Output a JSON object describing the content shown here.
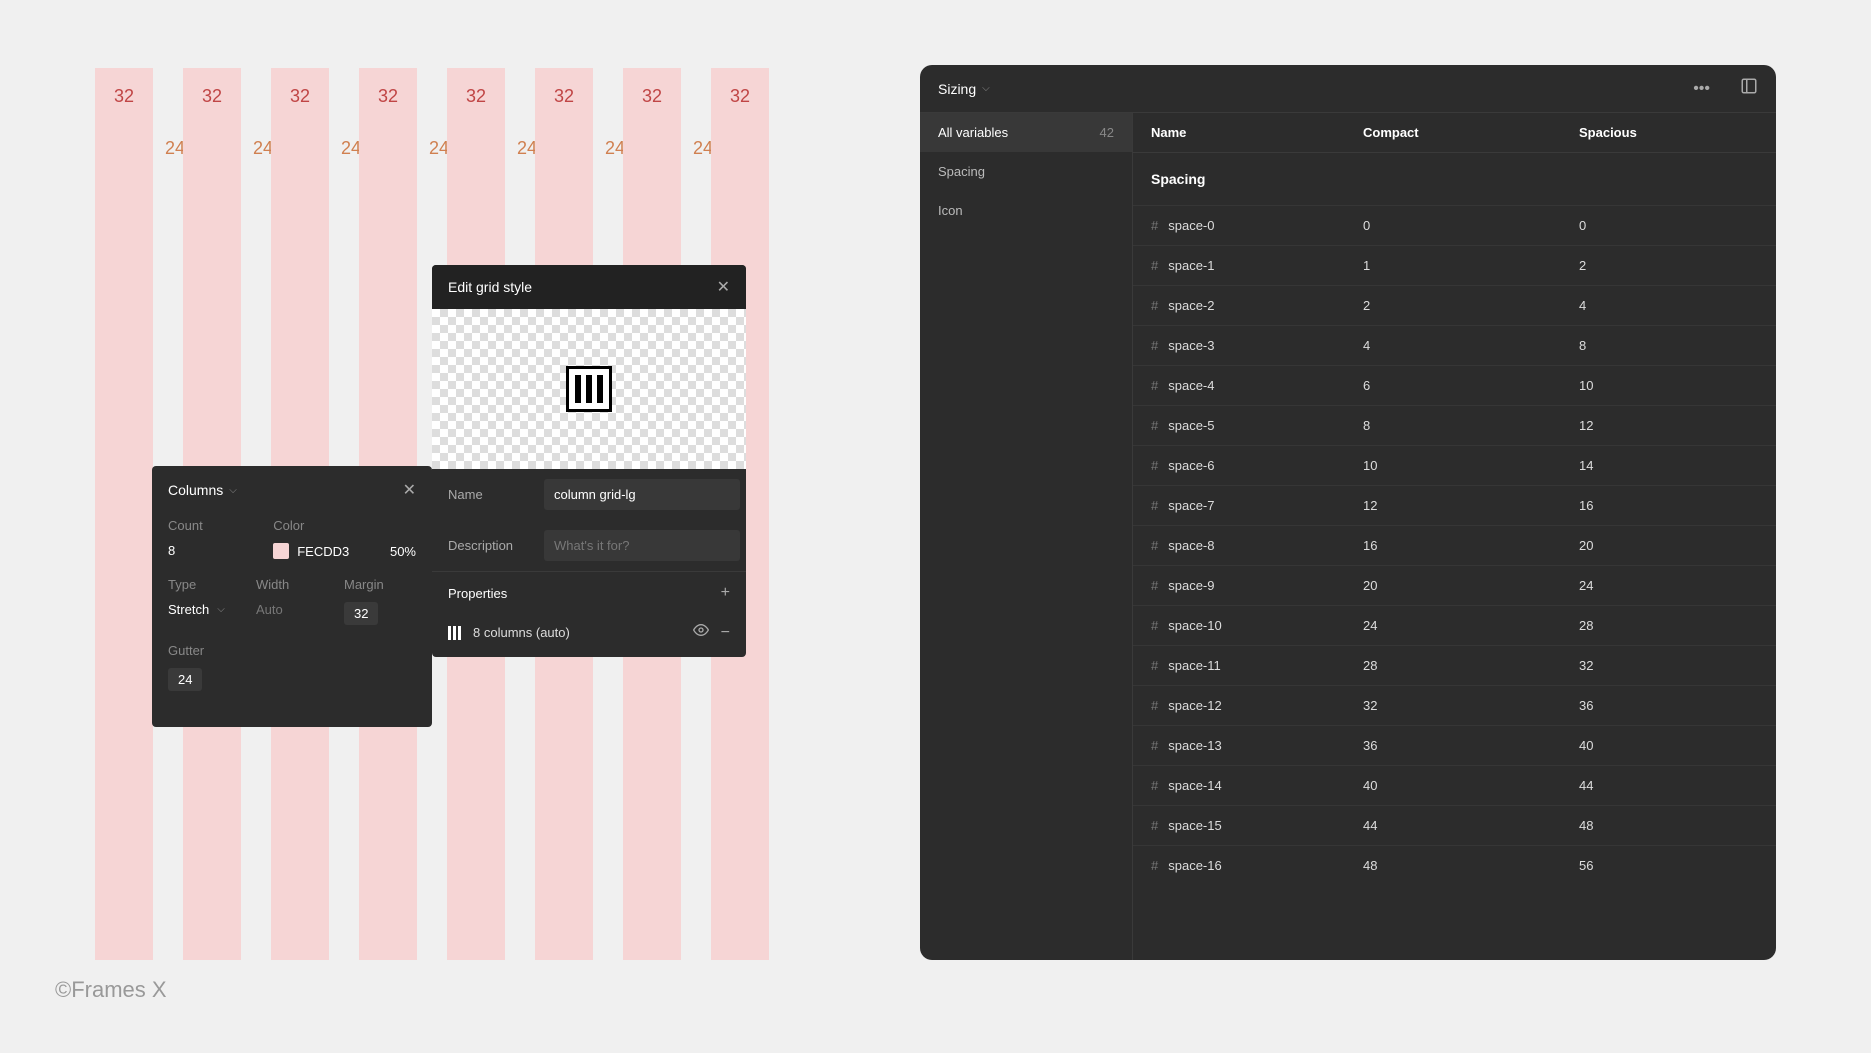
{
  "watermark": "©Frames X",
  "grid": {
    "col_label": "32",
    "gutter_label": "24"
  },
  "edit_panel": {
    "title": "Edit grid style",
    "name_label": "Name",
    "name_value": "column grid-lg",
    "desc_label": "Description",
    "desc_placeholder": "What's it for?",
    "properties_label": "Properties",
    "prop_text": "8 columns (auto)"
  },
  "columns_panel": {
    "title": "Columns",
    "count_label": "Count",
    "count_value": "8",
    "color_label": "Color",
    "color_hex": "FECDD3",
    "color_opacity": "50%",
    "type_label": "Type",
    "type_value": "Stretch",
    "width_label": "Width",
    "width_value": "Auto",
    "margin_label": "Margin",
    "margin_value": "32",
    "gutter_label": "Gutter",
    "gutter_value": "24"
  },
  "vars_panel": {
    "header": "Sizing",
    "sidebar": {
      "all_label": "All variables",
      "all_count": "42",
      "groups": [
        "Spacing",
        "Icon"
      ]
    },
    "columns": {
      "name": "Name",
      "compact": "Compact",
      "spacious": "Spacious"
    },
    "group_title": "Spacing",
    "rows": [
      {
        "name": "space-0",
        "compact": "0",
        "spacious": "0"
      },
      {
        "name": "space-1",
        "compact": "1",
        "spacious": "2"
      },
      {
        "name": "space-2",
        "compact": "2",
        "spacious": "4"
      },
      {
        "name": "space-3",
        "compact": "4",
        "spacious": "8"
      },
      {
        "name": "space-4",
        "compact": "6",
        "spacious": "10"
      },
      {
        "name": "space-5",
        "compact": "8",
        "spacious": "12"
      },
      {
        "name": "space-6",
        "compact": "10",
        "spacious": "14"
      },
      {
        "name": "space-7",
        "compact": "12",
        "spacious": "16"
      },
      {
        "name": "space-8",
        "compact": "16",
        "spacious": "20"
      },
      {
        "name": "space-9",
        "compact": "20",
        "spacious": "24"
      },
      {
        "name": "space-10",
        "compact": "24",
        "spacious": "28"
      },
      {
        "name": "space-11",
        "compact": "28",
        "spacious": "32"
      },
      {
        "name": "space-12",
        "compact": "32",
        "spacious": "36"
      },
      {
        "name": "space-13",
        "compact": "36",
        "spacious": "40"
      },
      {
        "name": "space-14",
        "compact": "40",
        "spacious": "44"
      },
      {
        "name": "space-15",
        "compact": "44",
        "spacious": "48"
      },
      {
        "name": "space-16",
        "compact": "48",
        "spacious": "56"
      }
    ]
  }
}
